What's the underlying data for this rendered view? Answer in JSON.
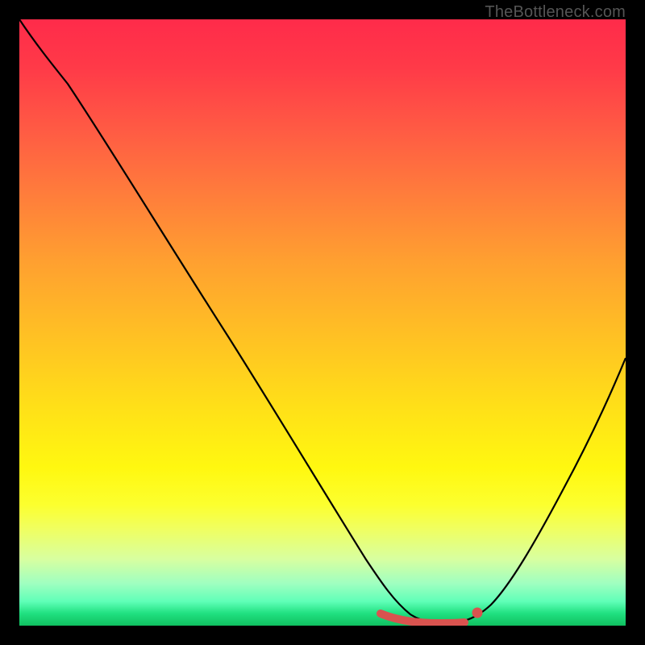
{
  "watermark": "TheBottleneck.com",
  "chart_data": {
    "type": "line",
    "title": "",
    "xlabel": "",
    "ylabel": "",
    "xlim": [
      0,
      1
    ],
    "ylim": [
      0,
      1
    ],
    "series": [
      {
        "name": "curve",
        "x": [
          0.0,
          0.06,
          0.12,
          0.2,
          0.3,
          0.4,
          0.5,
          0.58,
          0.62,
          0.66,
          0.7,
          0.73,
          0.76,
          0.82,
          0.88,
          0.94,
          1.0
        ],
        "y": [
          1.0,
          0.96,
          0.9,
          0.8,
          0.65,
          0.49,
          0.33,
          0.18,
          0.1,
          0.05,
          0.02,
          0.01,
          0.02,
          0.1,
          0.22,
          0.35,
          0.5
        ]
      }
    ],
    "highlight": {
      "name": "red-segment",
      "x": [
        0.595,
        0.64,
        0.69,
        0.73
      ],
      "y": [
        0.02,
        0.012,
        0.01,
        0.01
      ]
    },
    "marker": {
      "x": 0.755,
      "y": 0.022
    },
    "colors": {
      "curve": "#000000",
      "highlight": "#d9534f",
      "gradient_top": "#ff2b4a",
      "gradient_bottom": "#10c060"
    }
  }
}
